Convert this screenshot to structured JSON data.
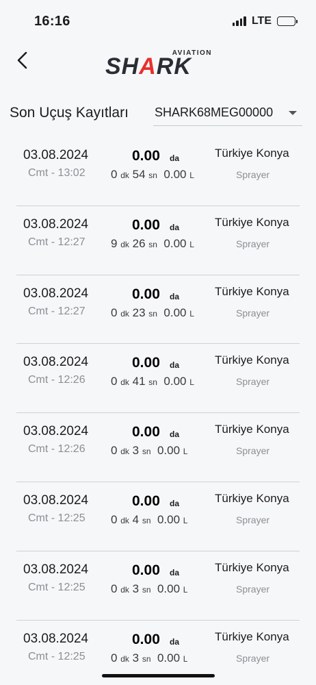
{
  "status_bar": {
    "time": "16:16",
    "network": "LTE"
  },
  "brand": {
    "top": "AVIATION",
    "pre": "SH",
    "accent": "A",
    "post": "RK"
  },
  "section": {
    "title": "Son Uçuş Kayıtları"
  },
  "device_select": {
    "value": "SHARK68MEG00000"
  },
  "units": {
    "area": "da",
    "minutes": "dk",
    "seconds": "sn",
    "liters": "L"
  },
  "flights": [
    {
      "date": "03.08.2024",
      "daytime": "Cmt - 13:02",
      "area": "0.00",
      "minutes": "0",
      "seconds": "54",
      "liters": "0.00",
      "location": "Türkiye Konya",
      "mode": "Sprayer"
    },
    {
      "date": "03.08.2024",
      "daytime": "Cmt - 12:27",
      "area": "0.00",
      "minutes": "9",
      "seconds": "26",
      "liters": "0.00",
      "location": "Türkiye Konya",
      "mode": "Sprayer"
    },
    {
      "date": "03.08.2024",
      "daytime": "Cmt - 12:27",
      "area": "0.00",
      "minutes": "0",
      "seconds": "23",
      "liters": "0.00",
      "location": "Türkiye Konya",
      "mode": "Sprayer"
    },
    {
      "date": "03.08.2024",
      "daytime": "Cmt - 12:26",
      "area": "0.00",
      "minutes": "0",
      "seconds": "41",
      "liters": "0.00",
      "location": "Türkiye Konya",
      "mode": "Sprayer"
    },
    {
      "date": "03.08.2024",
      "daytime": "Cmt - 12:26",
      "area": "0.00",
      "minutes": "0",
      "seconds": "3",
      "liters": "0.00",
      "location": "Türkiye Konya",
      "mode": "Sprayer"
    },
    {
      "date": "03.08.2024",
      "daytime": "Cmt - 12:25",
      "area": "0.00",
      "minutes": "0",
      "seconds": "4",
      "liters": "0.00",
      "location": "Türkiye Konya",
      "mode": "Sprayer"
    },
    {
      "date": "03.08.2024",
      "daytime": "Cmt - 12:25",
      "area": "0.00",
      "minutes": "0",
      "seconds": "3",
      "liters": "0.00",
      "location": "Türkiye Konya",
      "mode": "Sprayer"
    },
    {
      "date": "03.08.2024",
      "daytime": "Cmt - 12:25",
      "area": "0.00",
      "minutes": "0",
      "seconds": "3",
      "liters": "0.00",
      "location": "Türkiye Konya",
      "mode": "Sprayer"
    }
  ],
  "icons": {
    "back": "chevron-left-icon",
    "dropdown": "caret-down-icon",
    "signal": "cellular-signal-icon",
    "battery": "battery-icon"
  }
}
